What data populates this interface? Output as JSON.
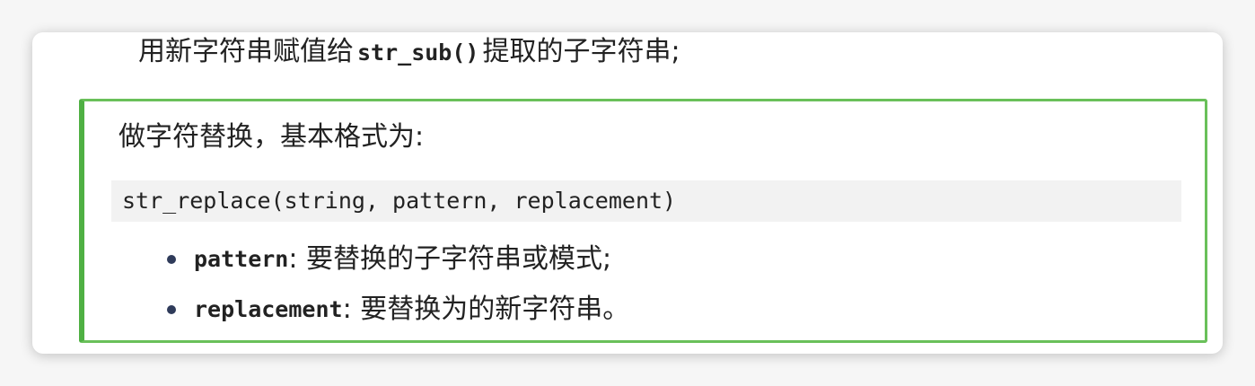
{
  "top_line": {
    "prefix": "用新字符串赋值给",
    "code": "str_sub()",
    "suffix": "提取的子字符串;"
  },
  "note": {
    "title": "做字符替换，基本格式为:",
    "code": "str_replace(string, pattern, replacement)",
    "bullets": [
      {
        "term": "pattern",
        "desc": ": 要替换的子字符串或模式;"
      },
      {
        "term": "replacement",
        "desc": ": 要替换为的新字符串。"
      }
    ]
  },
  "colors": {
    "note_border": "#6ac05a",
    "note_left_bar": "#4fb043",
    "code_background": "#f2f2f2",
    "bullet_dot": "#2f3b5a"
  }
}
